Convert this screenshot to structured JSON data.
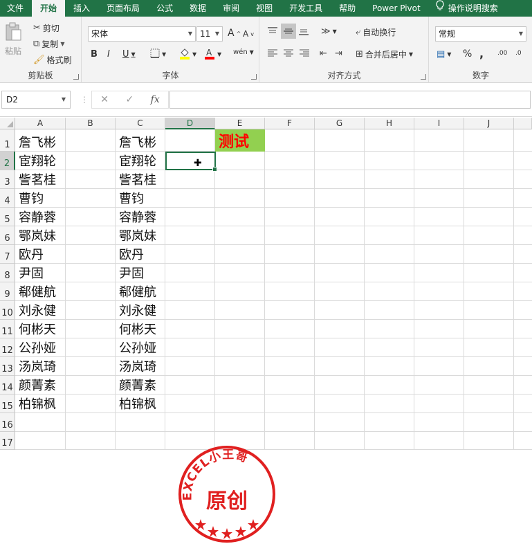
{
  "ribbon_tabs": [
    "文件",
    "开始",
    "插入",
    "页面布局",
    "公式",
    "数据",
    "审阅",
    "视图",
    "开发工具",
    "帮助",
    "Power Pivot"
  ],
  "active_tab": "开始",
  "tell_me": "操作说明搜索",
  "clipboard": {
    "paste": "粘贴",
    "cut": "剪切",
    "copy": "复制",
    "format_painter": "格式刷",
    "label": "剪贴板"
  },
  "font": {
    "name": "宋体",
    "size": "11",
    "bold": "B",
    "italic": "I",
    "underline": "U",
    "grow": "A",
    "shrink": "A",
    "phonetic": "wén",
    "label": "字体"
  },
  "alignment": {
    "wrap_text": "自动换行",
    "merge_center": "合并后居中",
    "label": "对齐方式"
  },
  "number": {
    "format": "常规",
    "percent": "%",
    "comma": ",",
    "inc_decimal": ".00",
    "dec_decimal": ".0",
    "label": "数字"
  },
  "formula_bar": {
    "name_box": "D2",
    "fx": "fx",
    "content": ""
  },
  "columns": [
    "A",
    "B",
    "C",
    "D",
    "E",
    "F",
    "G",
    "H",
    "I",
    "J"
  ],
  "rows": [
    "1",
    "2",
    "3",
    "4",
    "5",
    "6",
    "7",
    "8",
    "9",
    "10",
    "11",
    "12",
    "13",
    "14",
    "15",
    "16",
    "17"
  ],
  "selected_cell": "D2",
  "col_a": [
    "詹飞彬",
    "宦翔轮",
    "訾茗桂",
    "曹钧",
    "容静蓉",
    "鄂岚妹",
    "欧丹",
    "尹固",
    "郗健航",
    "刘永健",
    "何彬天",
    "公孙娅",
    "汤岚琦",
    "颜菁素",
    "柏锦枫"
  ],
  "col_c": [
    "詹飞彬",
    "宦翔轮",
    "訾茗桂",
    "曹钧",
    "容静蓉",
    "鄂岚妹",
    "欧丹",
    "尹固",
    "郗健航",
    "刘永健",
    "何彬天",
    "公孙娅",
    "汤岚琦",
    "颜菁素",
    "柏锦枫"
  ],
  "cell_e1": {
    "text": "测试",
    "fill": "#92d050",
    "color": "#ff0000"
  },
  "stamp": {
    "arc_text": "EXCEL小王哥",
    "center_text": "原创",
    "color": "#e02020"
  },
  "colors": {
    "excel_green": "#217346"
  }
}
